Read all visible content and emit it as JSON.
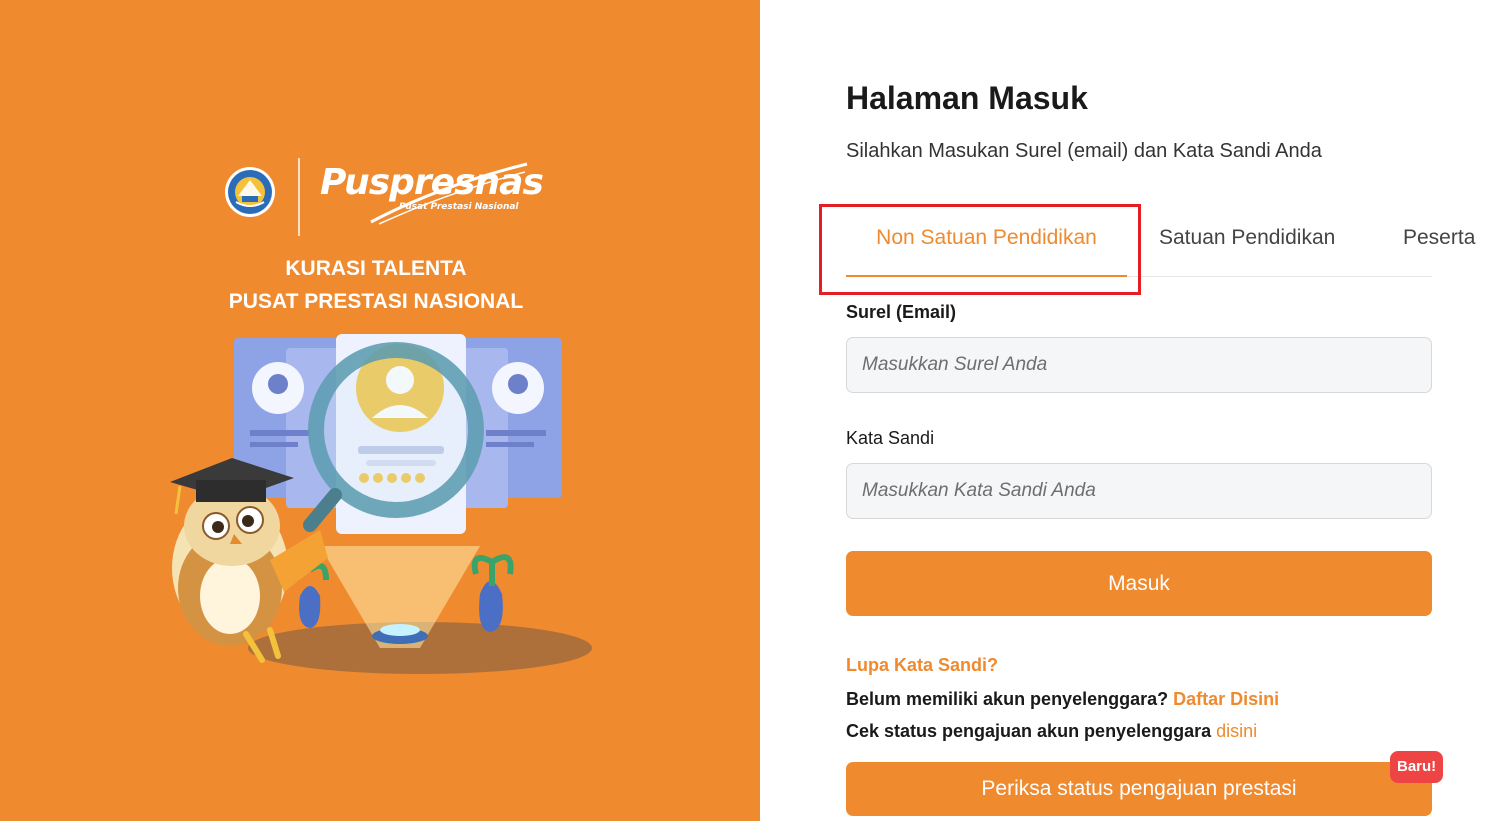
{
  "brand": {
    "name": "Puspresnas",
    "subtitle": "Pusat Prestasi Nasional",
    "tagline_line1": "KURASI TALENTA",
    "tagline_line2": "PUSAT PRESTASI NASIONAL"
  },
  "login": {
    "title": "Halaman Masuk",
    "subtitle": "Silahkan Masukan Surel (email) dan Kata Sandi Anda",
    "tabs": [
      {
        "label": "Non Satuan Pendidikan",
        "active": true
      },
      {
        "label": "Satuan Pendidikan",
        "active": false
      },
      {
        "label": "Peserta",
        "active": false
      }
    ],
    "email_label": "Surel (Email)",
    "email_placeholder": "Masukkan Surel Anda",
    "password_label": "Kata Sandi",
    "password_placeholder": "Masukkan Kata Sandi Anda",
    "submit_label": "Masuk",
    "forgot_label": "Lupa Kata Sandi?",
    "register_prompt": "Belum memiliki akun penyelenggara?",
    "register_link": "Daftar Disini",
    "status_prompt": "Cek status pengajuan akun penyelenggara",
    "status_link": "disini",
    "check_status_button": "Periksa status pengajuan prestasi",
    "new_badge": "Baru!"
  },
  "colors": {
    "brand_orange": "#ef8a2f",
    "highlight_red": "#e31e24",
    "badge_red": "#ef4444"
  }
}
